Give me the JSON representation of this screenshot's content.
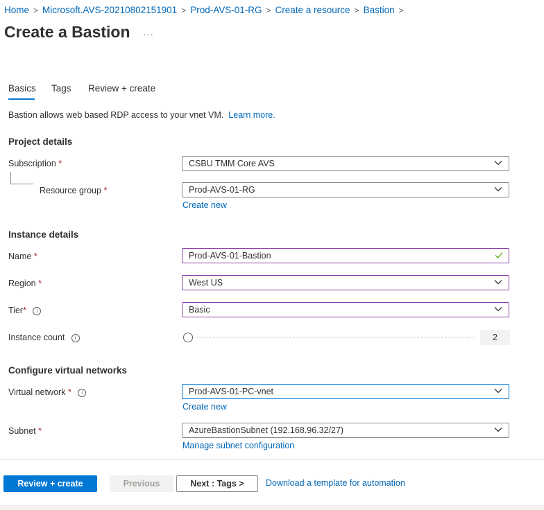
{
  "breadcrumb": [
    "Home",
    "Microsoft.AVS-20210802151901",
    "Prod-AVS-01-RG",
    "Create a resource",
    "Bastion"
  ],
  "breadcrumb_sep": ">",
  "page_title": "Create a Bastion",
  "more_label": "···",
  "tabs": [
    {
      "label": "Basics",
      "active": true
    },
    {
      "label": "Tags",
      "active": false
    },
    {
      "label": "Review + create",
      "active": false
    }
  ],
  "intro": {
    "text": "Bastion allows web based RDP access to your vnet VM.",
    "link": "Learn more."
  },
  "required_mark": "*",
  "info_glyph": "i",
  "project_details": {
    "heading": "Project details",
    "subscription": {
      "label": "Subscription",
      "value": "CSBU TMM Core AVS"
    },
    "resource_group": {
      "label": "Resource group",
      "value": "Prod-AVS-01-RG",
      "create_new": "Create new"
    }
  },
  "instance_details": {
    "heading": "Instance details",
    "name": {
      "label": "Name",
      "value": "Prod-AVS-01-Bastion"
    },
    "region": {
      "label": "Region",
      "value": "West US"
    },
    "tier": {
      "label": "Tier",
      "value": "Basic"
    },
    "instance_count": {
      "label": "Instance count",
      "value": "2",
      "slider_fraction": 0
    }
  },
  "virtual_networks": {
    "heading": "Configure virtual networks",
    "virtual_network": {
      "label": "Virtual network",
      "value": "Prod-AVS-01-PC-vnet",
      "create_new": "Create new"
    },
    "subnet": {
      "label": "Subnet",
      "value": "AzureBastionSubnet (192.168.96.32/27)",
      "manage": "Manage subnet configuration"
    }
  },
  "footer": {
    "review_create": "Review + create",
    "previous": "Previous",
    "next": "Next : Tags >",
    "download": "Download a template for automation"
  },
  "colors": {
    "accent": "#0078d4",
    "link": "#0067b8",
    "required": "#a4262c",
    "focus_border": "#8b3fa6",
    "valid_check": "#57a300"
  },
  "icons": {
    "dropdown": "chevron-down-icon",
    "valid": "checkmark-icon",
    "info": "info-icon"
  }
}
